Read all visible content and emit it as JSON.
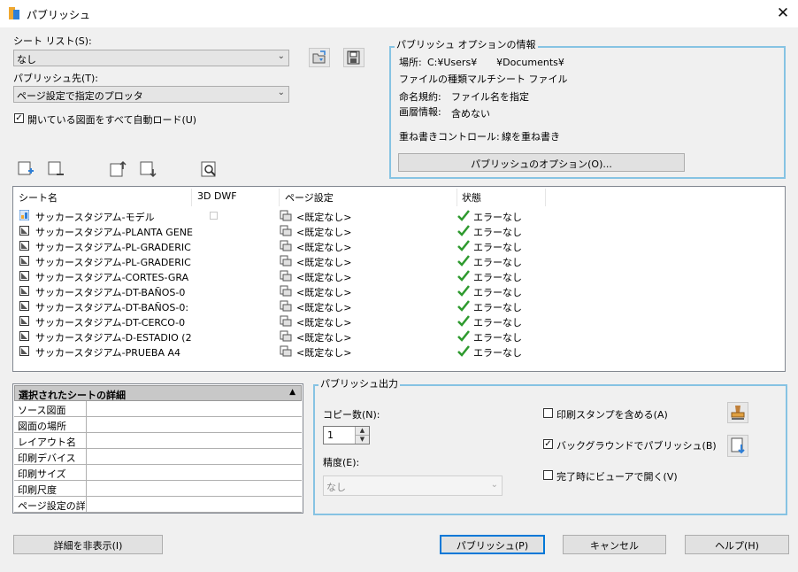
{
  "window": {
    "title": "パブリッシュ",
    "close_glyph": "✕"
  },
  "sheet_list": {
    "label": "シート リスト(S):",
    "value": "なし"
  },
  "publish_to": {
    "label": "パブリッシュ先(T):",
    "value": "ページ設定で指定のプロッタ"
  },
  "auto_load": {
    "label": "開いている図面をすべて自動ロード(U)",
    "checked": true
  },
  "publish_options": {
    "group_title": "パブリッシュ オプションの情報",
    "location_label": "場所:",
    "location_value": "C:¥Users¥　　¥Documents¥",
    "file_type": "ファイルの種類マルチシート ファイル",
    "naming_label": "命名規約:",
    "naming_value": "ファイル名を指定",
    "layer_label": "画層情報:",
    "layer_value": "含めない",
    "overwrite_label": "重ね書きコントロール:",
    "overwrite_value": "線を重ね書き",
    "options_button": "パブリッシュのオプション(O)..."
  },
  "list": {
    "headers": {
      "name": "シート名",
      "dwf3d": "3D DWF",
      "page_setup": "ページ設定",
      "status": "状態"
    },
    "rows": [
      {
        "name": "サッカースタジアム-モデル",
        "kind": "model",
        "page_setup": "<既定なし>",
        "status": "エラーなし"
      },
      {
        "name": "サッカースタジアム-PLANTA GENE",
        "kind": "layout",
        "page_setup": "<既定なし>",
        "status": "エラーなし"
      },
      {
        "name": "サッカースタジアム-PL-GRADERIC",
        "kind": "layout",
        "page_setup": "<既定なし>",
        "status": "エラーなし"
      },
      {
        "name": "サッカースタジアム-PL-GRADERIC",
        "kind": "layout",
        "page_setup": "<既定なし>",
        "status": "エラーなし"
      },
      {
        "name": "サッカースタジアム-CORTES-GRA",
        "kind": "layout",
        "page_setup": "<既定なし>",
        "status": "エラーなし"
      },
      {
        "name": "サッカースタジアム-DT-BAÑOS-0",
        "kind": "layout",
        "page_setup": "<既定なし>",
        "status": "エラーなし"
      },
      {
        "name": "サッカースタジアム-DT-BAÑOS-0:",
        "kind": "layout",
        "page_setup": "<既定なし>",
        "status": "エラーなし"
      },
      {
        "name": "サッカースタジアム-DT-CERCO-0",
        "kind": "layout",
        "page_setup": "<既定なし>",
        "status": "エラーなし"
      },
      {
        "name": "サッカースタジアム-D-ESTADIO (2",
        "kind": "layout",
        "page_setup": "<既定なし>",
        "status": "エラーなし"
      },
      {
        "name": "サッカースタジアム-PRUEBA A4",
        "kind": "layout",
        "page_setup": "<既定なし>",
        "status": "エラーなし"
      }
    ]
  },
  "details": {
    "title": "選択されたシートの詳細",
    "rows": [
      "ソース図面",
      "図面の場所",
      "レイアウト名",
      "印刷デバイス",
      "印刷サイズ",
      "印刷尺度",
      "ページ設定の詳"
    ]
  },
  "output": {
    "group_title": "パブリッシュ出力",
    "copies_label": "コピー数(N):",
    "copies_value": "1",
    "precision_label": "精度(E):",
    "precision_value": "なし",
    "include_stamp": {
      "label": "印刷スタンプを含める(A)",
      "checked": false
    },
    "background": {
      "label": "バックグラウンドでパブリッシュ(B)",
      "checked": true
    },
    "open_viewer": {
      "label": "完了時にビューアで開く(V)",
      "checked": false
    }
  },
  "buttons": {
    "hide_details": "詳細を非表示(I)",
    "publish": "パブリッシュ(P)",
    "cancel": "キャンセル",
    "help": "ヘルプ(H)"
  },
  "colors": {
    "accent": "#0078d7",
    "group_border": "#86c3e3",
    "check_green": "#2e9a2e"
  }
}
